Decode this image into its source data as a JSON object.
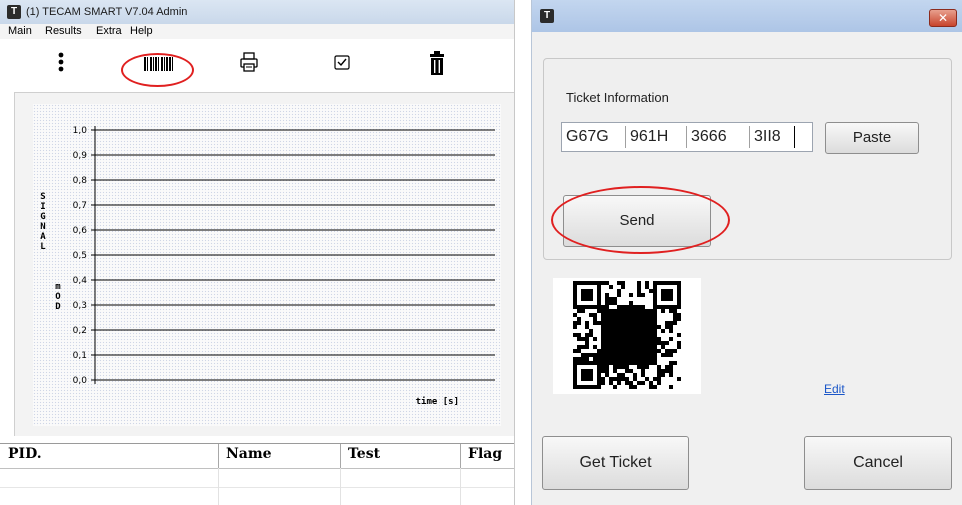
{
  "left_window": {
    "app_icon": "T",
    "title": "(1) TECAM SMART  V7.04 Admin",
    "menu": [
      "Main",
      "Results",
      "Extra",
      "Help"
    ],
    "toolbar": {
      "icons": [
        "more-vertical-icon",
        "barcode-icon",
        "printer-icon",
        "checkbox-icon",
        "trash-icon"
      ]
    },
    "chart": {
      "y_label_top": "SIGNAL",
      "y_label_bottom": "mOD",
      "x_label": "time [s]"
    },
    "table": {
      "columns": [
        "PID.",
        "Name",
        "Test",
        "Flag"
      ]
    }
  },
  "right_window": {
    "icon": "T",
    "close_icon": "close-icon",
    "ticket_label": "Ticket Information",
    "ticket_segments": [
      "G67G",
      "961H",
      "3666",
      "3II8"
    ],
    "paste_label": "Paste",
    "send_label": "Send",
    "edit_label": "Edit",
    "get_ticket_label": "Get Ticket",
    "cancel_label": "Cancel"
  },
  "colors": {
    "highlight": "#e02020",
    "titlebar": "#c3d6ef",
    "link": "#1a56c8"
  },
  "chart_data": {
    "type": "line",
    "title": "",
    "xlabel": "time [s]",
    "ylabel": "SIGNAL mOD",
    "y_ticks": [
      "1,0",
      "0,9",
      "0,8",
      "0,7",
      "0,6",
      "0,5",
      "0,4",
      "0,3",
      "0,2",
      "0,1",
      "0,0"
    ],
    "ylim": [
      0,
      1
    ],
    "series": [],
    "grid": true
  }
}
